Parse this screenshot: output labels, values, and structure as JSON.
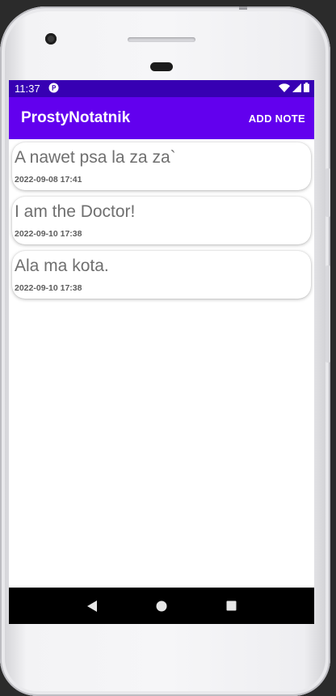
{
  "status_bar": {
    "time": "11:37"
  },
  "app_bar": {
    "title": "ProstyNotatnik",
    "add_note_label": "ADD NOTE"
  },
  "notes": [
    {
      "text": "A nawet psa la za za`",
      "date": "2022-09-08 17:41"
    },
    {
      "text": "I am the Doctor!",
      "date": "2022-09-10 17:38"
    },
    {
      "text": "Ala ma kota.",
      "date": "2022-09-10 17:38"
    }
  ],
  "icons": {
    "status_app": "notification-app-icon",
    "wifi": "wifi-icon",
    "signal": "signal-icon",
    "battery": "battery-icon",
    "back": "back-icon",
    "home": "home-icon",
    "recents": "recents-icon"
  },
  "colors": {
    "status_bar": "#3700b3",
    "app_bar": "#6200ee",
    "note_text": "#6f6f6f",
    "nav_bar": "#000000"
  }
}
